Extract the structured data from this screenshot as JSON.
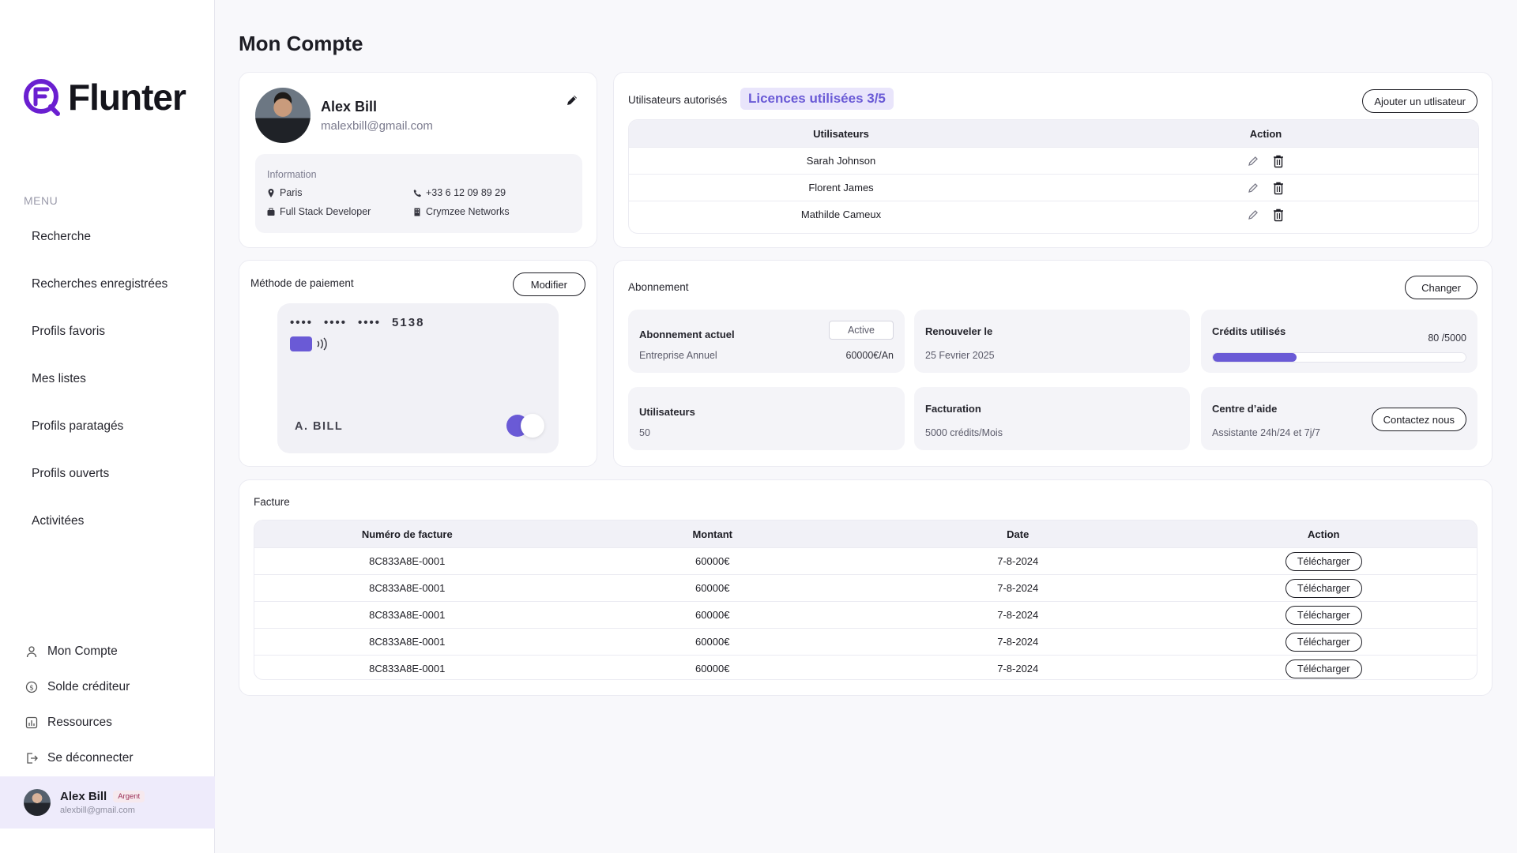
{
  "app": {
    "brand": "Flunter",
    "brand_color": "#6a5ad6"
  },
  "sidebar": {
    "menu_label": "MENU",
    "items": [
      {
        "label": "Recherche"
      },
      {
        "label": "Recherches enregistrées"
      },
      {
        "label": "Profils favoris"
      },
      {
        "label": "Mes listes"
      },
      {
        "label": "Profils paratagés"
      },
      {
        "label": "Profils ouverts"
      },
      {
        "label": "Activitées"
      }
    ],
    "bottom": [
      {
        "label": "Mon Compte",
        "icon": "user-icon"
      },
      {
        "label": "Solde créditeur",
        "icon": "dollar-icon"
      },
      {
        "label": "Ressources",
        "icon": "chart-icon"
      },
      {
        "label": "Se déconnecter",
        "icon": "logout-icon"
      }
    ],
    "user": {
      "name": "Alex Bill",
      "badge": "Argent",
      "email": "alexbill@gmail.com"
    }
  },
  "page": {
    "title": "Mon Compte"
  },
  "profile": {
    "name": "Alex Bill",
    "email": "malexbill@gmail.com",
    "info_title": "Information",
    "city": "Paris",
    "phone": "+33 6 12 09 89 29",
    "role": "Full Stack Developer",
    "company": "Crymzee Networks"
  },
  "users": {
    "title": "Utilisateurs autorisés",
    "licenses": "Licences utilisées 3/5",
    "add_button": "Ajouter un utlisateur",
    "columns": [
      "Utilisateurs",
      "Action"
    ],
    "rows": [
      {
        "name": "Sarah Johnson"
      },
      {
        "name": "Florent James"
      },
      {
        "name": "Mathilde Cameux"
      }
    ]
  },
  "payment": {
    "title": "Méthode de paiement",
    "modify_button": "Modifier",
    "card_masked": [
      "••••",
      "••••",
      "••••"
    ],
    "card_last4": "5138",
    "holder": "A. BILL",
    "enabled": true
  },
  "subscription": {
    "title": "Abonnement",
    "change_button": "Changer",
    "current_label": "Abonnement actuel",
    "status": "Active",
    "plan": "Entreprise Annuel",
    "price": "60000€/An",
    "renew_label": "Renouveler le",
    "renew_date": "25 Fevrier 2025",
    "credits_label": "Crédits utilisés",
    "credits_text": "80 /5000",
    "credits_progress_fraction": 0.33,
    "users_label": "Utilisateurs",
    "users_count": "50",
    "billing_label": "Facturation",
    "billing_value": "5000 crédits/Mois",
    "help_label": "Centre d’aide",
    "help_value": "Assistante 24h/24 et 7j/7",
    "contact_button": "Contactez nous"
  },
  "invoices": {
    "title": "Facture",
    "columns": [
      "Numéro de facture",
      "Montant",
      "Date",
      "Action"
    ],
    "rows": [
      {
        "number": "8C833A8E-0001",
        "amount": "60000€",
        "date": "7-8-2024",
        "action": "Télécharger"
      },
      {
        "number": "8C833A8E-0001",
        "amount": "60000€",
        "date": "7-8-2024",
        "action": "Télécharger"
      },
      {
        "number": "8C833A8E-0001",
        "amount": "60000€",
        "date": "7-8-2024",
        "action": "Télécharger"
      },
      {
        "number": "8C833A8E-0001",
        "amount": "60000€",
        "date": "7-8-2024",
        "action": "Télécharger"
      },
      {
        "number": "8C833A8E-0001",
        "amount": "60000€",
        "date": "7-8-2024",
        "action": "Télécharger"
      }
    ]
  }
}
